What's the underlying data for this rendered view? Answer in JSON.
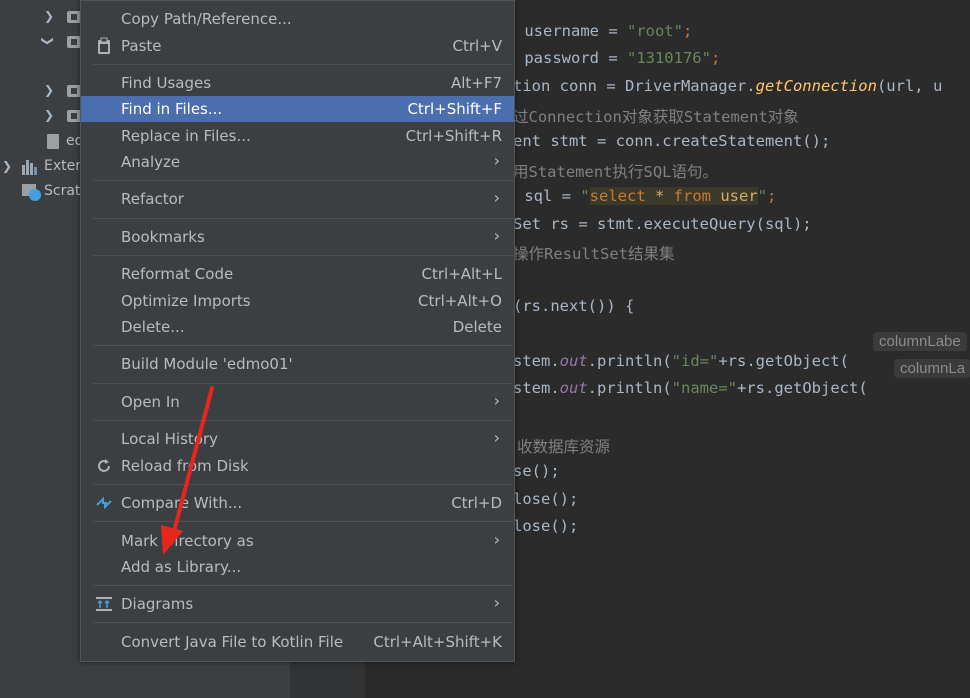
{
  "tree": {
    "items": [
      {
        "label": "",
        "expanded": false
      },
      {
        "label": "",
        "expanded": true
      },
      {
        "label": "",
        "expanded": false
      },
      {
        "label": "",
        "expanded": false
      },
      {
        "label": "ed"
      },
      {
        "label": "Exter"
      },
      {
        "label": "Scrat"
      }
    ]
  },
  "code": {
    "l1": {
      "a": " username = ",
      "b": "\"root\"",
      "c": ";"
    },
    "l2": {
      "a": " password = ",
      "b": "\"1310176\"",
      "c": ";"
    },
    "l3": {
      "a": "tion conn = DriverManager.",
      "b": "getConnection",
      "c": "(url, u"
    },
    "l4": "过Connection对象获取Statement对象",
    "l5": "ent stmt = conn.createStatement();",
    "l6": "用Statement执行SQL语句。",
    "l7": {
      "a": " sql = ",
      "q1": "\"",
      "s1": "select ",
      "s2": "* ",
      "s3": "from ",
      "s4": "user",
      "q2": "\"",
      "c": ";"
    },
    "l8": "Set rs = stmt.executeQuery(sql);",
    "l9": "操作ResultSet结果集",
    "l10": "(rs.next()) {",
    "l11": {
      "a": "stem.",
      "b": "out",
      "c": ".println(",
      "d": "\"id=\"",
      "e": "+rs.getObject(",
      "hint": "columnLabe"
    },
    "l12": {
      "a": "stem.",
      "b": "out",
      "c": ".println(",
      "d": "\"name=\"",
      "e": "+rs.getObject(",
      "hint": "columnLa"
    },
    "l13": "收数据库资源",
    "l14": "se();",
    "l15": "lose();",
    "l16": "lose();"
  },
  "menu": {
    "copy_path": "Copy Path/Reference...",
    "paste": {
      "label": "Paste",
      "shortcut": "Ctrl+V"
    },
    "find_usages": {
      "label": "Find Usages",
      "shortcut": "Alt+F7"
    },
    "find_in_files": {
      "label": "Find in Files...",
      "shortcut": "Ctrl+Shift+F"
    },
    "replace_in_files": {
      "label": "Replace in Files...",
      "shortcut": "Ctrl+Shift+R"
    },
    "analyze": "Analyze",
    "refactor": "Refactor",
    "bookmarks": "Bookmarks",
    "reformat_code": {
      "label": "Reformat Code",
      "shortcut": "Ctrl+Alt+L"
    },
    "optimize_imports": {
      "label": "Optimize Imports",
      "shortcut": "Ctrl+Alt+O"
    },
    "delete": {
      "label": "Delete...",
      "shortcut": "Delete"
    },
    "build_module": "Build Module 'edmo01'",
    "open_in": "Open In",
    "local_history": "Local History",
    "reload_from_disk": "Reload from Disk",
    "compare_with": {
      "label": "Compare With...",
      "shortcut": "Ctrl+D"
    },
    "mark_directory_as": "Mark Directory as",
    "add_as_library": "Add as Library...",
    "diagrams": "Diagrams",
    "convert_kotlin": {
      "label": "Convert Java File to Kotlin File",
      "shortcut": "Ctrl+Alt+Shift+K"
    }
  },
  "colors": {
    "menu_bg": "#3c3f41",
    "selection": "#4b6eaf",
    "editor_bg": "#2b2b2b",
    "annotation": "#e8261e"
  }
}
